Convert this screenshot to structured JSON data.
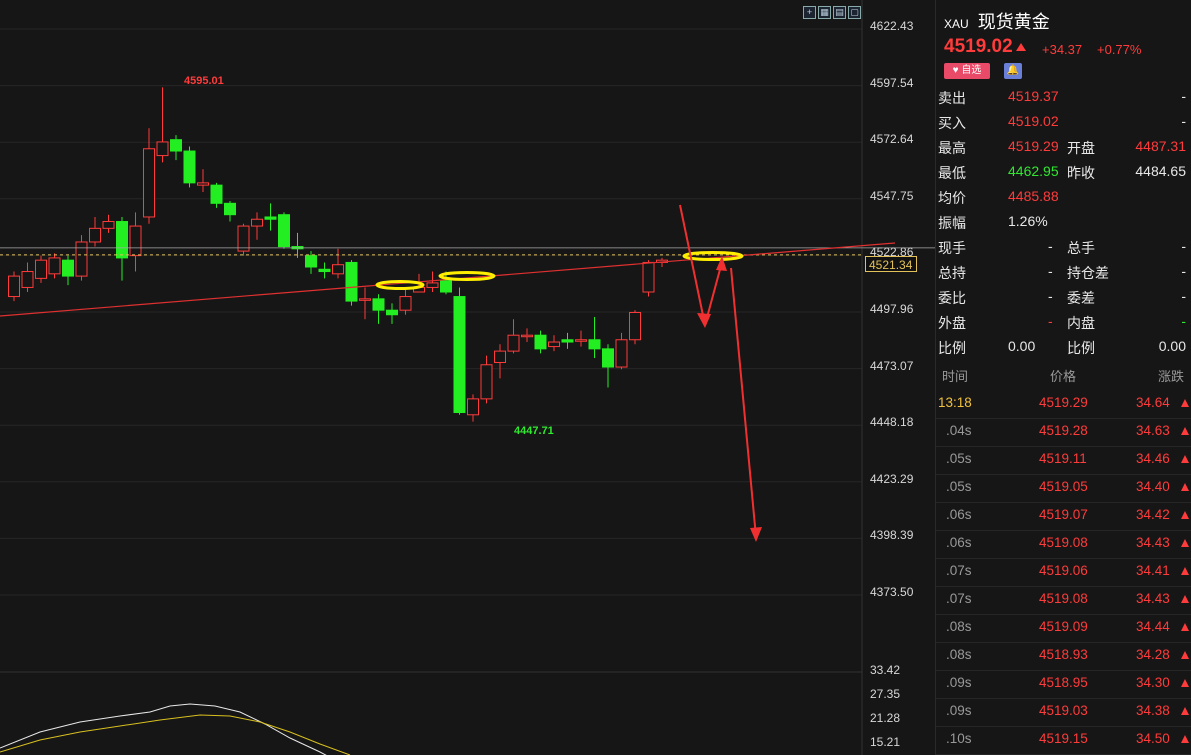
{
  "header": {
    "symbol": "XAU",
    "name": "现货黄金"
  },
  "quote": {
    "price": "4519.02",
    "change": "+34.37",
    "change_pct": "+0.77%"
  },
  "buttons": {
    "favorite": "自选"
  },
  "stats": [
    {
      "l1": "卖出",
      "v1": "4519.37",
      "c1": "red",
      "l2": "",
      "v2": "-",
      "c2": "white"
    },
    {
      "l1": "买入",
      "v1": "4519.02",
      "c1": "red",
      "l2": "",
      "v2": "-",
      "c2": "white"
    },
    {
      "l1": "最高",
      "v1": "4519.29",
      "c1": "red",
      "l2": "开盘",
      "v2": "4487.31",
      "c2": "red"
    },
    {
      "l1": "最低",
      "v1": "4462.95",
      "c1": "green",
      "l2": "昨收",
      "v2": "4484.65",
      "c2": "white"
    },
    {
      "l1": "均价",
      "v1": "4485.88",
      "c1": "red",
      "l2": "",
      "v2": "",
      "c2": "white"
    },
    {
      "l1": "振幅",
      "v1": "1.26%",
      "c1": "white",
      "l2": "",
      "v2": "",
      "c2": "white"
    },
    {
      "l1": "现手",
      "v1": "-",
      "c1": "white",
      "l2": "总手",
      "v2": "-",
      "c2": "white"
    },
    {
      "l1": "总持",
      "v1": "-",
      "c1": "white",
      "l2": "持仓差",
      "v2": "-",
      "c2": "white"
    },
    {
      "l1": "委比",
      "v1": "-",
      "c1": "white",
      "l2": "委差",
      "v2": "-",
      "c2": "white"
    },
    {
      "l1": "外盘",
      "v1": "-",
      "c1": "red",
      "l2": "内盘",
      "v2": "-",
      "c2": "green"
    },
    {
      "l1": "比例",
      "v1": "0.00",
      "c1": "white",
      "l2": "比例",
      "v2": "0.00",
      "c2": "white"
    }
  ],
  "ticks_header": {
    "time": "时间",
    "price": "价格",
    "change": "涨跌"
  },
  "ticks": [
    {
      "time": "13:18",
      "price": "4519.29",
      "change": "34.64"
    },
    {
      "time": ".04s",
      "price": "4519.28",
      "change": "34.63"
    },
    {
      "time": ".05s",
      "price": "4519.11",
      "change": "34.46"
    },
    {
      "time": ".05s",
      "price": "4519.05",
      "change": "34.40"
    },
    {
      "time": ".06s",
      "price": "4519.07",
      "change": "34.42"
    },
    {
      "time": ".06s",
      "price": "4519.08",
      "change": "34.43"
    },
    {
      "time": ".07s",
      "price": "4519.06",
      "change": "34.41"
    },
    {
      "time": ".07s",
      "price": "4519.08",
      "change": "34.43"
    },
    {
      "time": ".08s",
      "price": "4519.09",
      "change": "34.44"
    },
    {
      "time": ".08s",
      "price": "4518.93",
      "change": "34.28"
    },
    {
      "time": ".09s",
      "price": "4518.95",
      "change": "34.30"
    },
    {
      "time": ".09s",
      "price": "4519.03",
      "change": "34.38"
    },
    {
      "time": ".10s",
      "price": "4519.15",
      "change": "34.50"
    }
  ],
  "axis": {
    "price_ticks": [
      "4622.43",
      "4597.54",
      "4572.64",
      "4547.75",
      "4522.86",
      "4497.96",
      "4473.07",
      "4448.18",
      "4423.29",
      "4398.39",
      "4373.50"
    ],
    "indicator_ticks": [
      "33.42",
      "27.35",
      "21.28",
      "15.21"
    ],
    "current_price": "4521.34",
    "high_label": "4595.01",
    "low_label": "4447.71"
  },
  "colors": {
    "up": "#ff3b3b",
    "down": "#22ee22",
    "background": "#161616",
    "grid": "#2a2a2a",
    "highlight": "#ffee00"
  },
  "chart_data": {
    "type": "candlestick",
    "ylim": [
      4373.5,
      4622.43
    ],
    "candles": [
      {
        "o": 4503,
        "c": 4512,
        "h": 4514,
        "l": 4501
      },
      {
        "o": 4507,
        "c": 4514,
        "h": 4518,
        "l": 4505
      },
      {
        "o": 4511,
        "c": 4519,
        "h": 4521,
        "l": 4509
      },
      {
        "o": 4513,
        "c": 4520,
        "h": 4522,
        "l": 4511
      },
      {
        "o": 4519,
        "c": 4512,
        "h": 4521,
        "l": 4508
      },
      {
        "o": 4512,
        "c": 4527,
        "h": 4530,
        "l": 4510
      },
      {
        "o": 4527,
        "c": 4533,
        "h": 4538,
        "l": 4525
      },
      {
        "o": 4533,
        "c": 4536,
        "h": 4539,
        "l": 4531
      },
      {
        "o": 4536,
        "c": 4520,
        "h": 4538,
        "l": 4510
      },
      {
        "o": 4521,
        "c": 4534,
        "h": 4540,
        "l": 4514
      },
      {
        "o": 4538,
        "c": 4568,
        "h": 4577,
        "l": 4535
      },
      {
        "o": 4565,
        "c": 4571,
        "h": 4595,
        "l": 4562
      },
      {
        "o": 4572,
        "c": 4567,
        "h": 4574,
        "l": 4563
      },
      {
        "o": 4567,
        "c": 4553,
        "h": 4569,
        "l": 4551
      },
      {
        "o": 4552,
        "c": 4553,
        "h": 4559,
        "l": 4549
      },
      {
        "o": 4552,
        "c": 4544,
        "h": 4553,
        "l": 4542
      },
      {
        "o": 4544,
        "c": 4539,
        "h": 4545,
        "l": 4536
      },
      {
        "o": 4523,
        "c": 4534,
        "h": 4535,
        "l": 4521
      },
      {
        "o": 4534,
        "c": 4537,
        "h": 4540,
        "l": 4528
      },
      {
        "o": 4538,
        "c": 4537,
        "h": 4544,
        "l": 4532
      },
      {
        "o": 4539,
        "c": 4525,
        "h": 4540,
        "l": 4524
      },
      {
        "o": 4525,
        "c": 4524,
        "h": 4531,
        "l": 4520
      },
      {
        "o": 4521,
        "c": 4516,
        "h": 4523,
        "l": 4513
      },
      {
        "o": 4515,
        "c": 4514,
        "h": 4518,
        "l": 4511
      },
      {
        "o": 4513,
        "c": 4517,
        "h": 4524,
        "l": 4511
      },
      {
        "o": 4518,
        "c": 4501,
        "h": 4519,
        "l": 4499
      },
      {
        "o": 4502,
        "c": 4502,
        "h": 4507,
        "l": 4493
      },
      {
        "o": 4502,
        "c": 4497,
        "h": 4504,
        "l": 4491
      },
      {
        "o": 4497,
        "c": 4495,
        "h": 4500,
        "l": 4491
      },
      {
        "o": 4497,
        "c": 4503,
        "h": 4507,
        "l": 4495
      },
      {
        "o": 4505,
        "c": 4507,
        "h": 4513,
        "l": 4505
      },
      {
        "o": 4507,
        "c": 4509,
        "h": 4514,
        "l": 4505
      },
      {
        "o": 4510,
        "c": 4505,
        "h": 4514,
        "l": 4504
      },
      {
        "o": 4503,
        "c": 4452,
        "h": 4507,
        "l": 4451
      },
      {
        "o": 4451,
        "c": 4458,
        "h": 4460,
        "l": 4448
      },
      {
        "o": 4458,
        "c": 4473,
        "h": 4477,
        "l": 4456
      },
      {
        "o": 4474,
        "c": 4479,
        "h": 4482,
        "l": 4467
      },
      {
        "o": 4479,
        "c": 4486,
        "h": 4493,
        "l": 4478
      },
      {
        "o": 4486,
        "c": 4486,
        "h": 4489,
        "l": 4483
      },
      {
        "o": 4486,
        "c": 4480,
        "h": 4488,
        "l": 4478
      },
      {
        "o": 4481,
        "c": 4483,
        "h": 4486,
        "l": 4479
      },
      {
        "o": 4484,
        "c": 4483,
        "h": 4487,
        "l": 4480
      },
      {
        "o": 4484,
        "c": 4484,
        "h": 4488,
        "l": 4481
      },
      {
        "o": 4484,
        "c": 4480,
        "h": 4494,
        "l": 4476
      },
      {
        "o": 4480,
        "c": 4472,
        "h": 4482,
        "l": 4463
      },
      {
        "o": 4472,
        "c": 4484,
        "h": 4487,
        "l": 4471
      },
      {
        "o": 4484,
        "c": 4496,
        "h": 4497,
        "l": 4482
      },
      {
        "o": 4505,
        "c": 4518,
        "h": 4519,
        "l": 4503
      },
      {
        "o": 4518,
        "c": 4519,
        "h": 4520,
        "l": 4516
      }
    ]
  }
}
